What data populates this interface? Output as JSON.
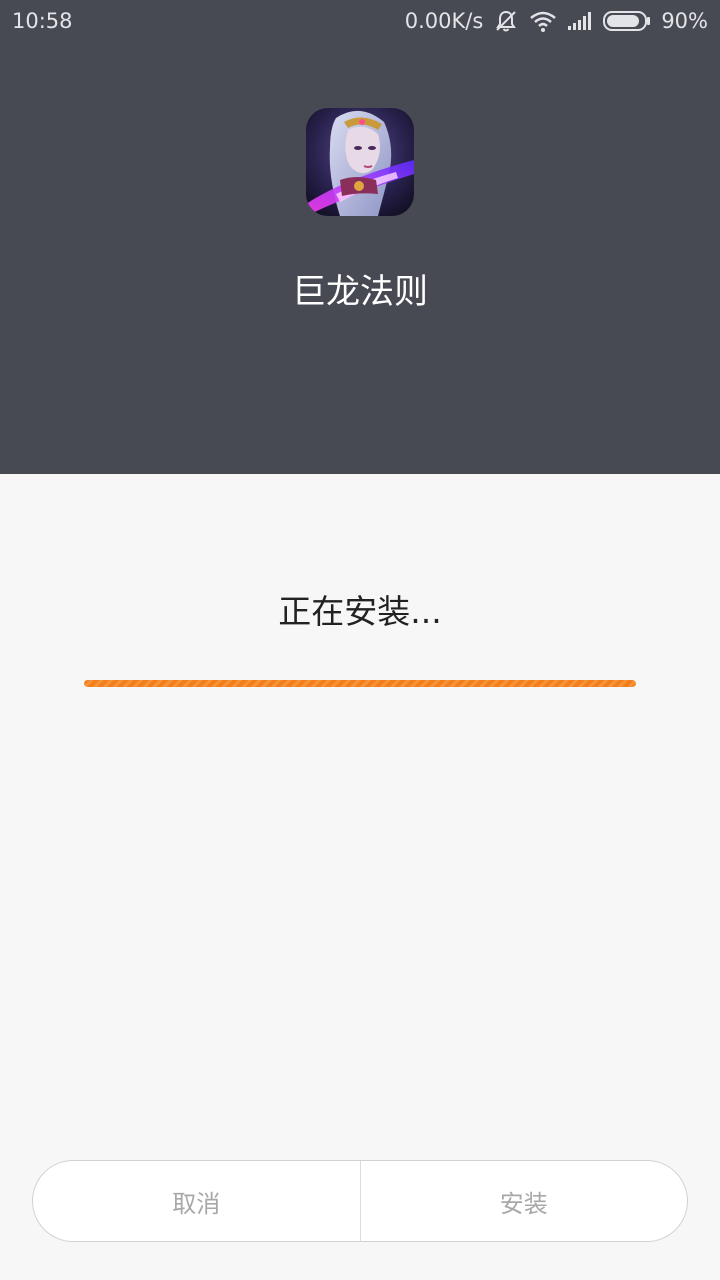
{
  "status_bar": {
    "time": "10:58",
    "network_speed": "0.00K/s",
    "battery_percent": "90%",
    "battery_level": 0.9,
    "icons": [
      "mute-icon",
      "wifi-icon",
      "signal-icon",
      "battery-icon"
    ]
  },
  "app": {
    "name": "巨龙法则",
    "icon": "app-icon"
  },
  "install": {
    "status_text": "正在安装...",
    "progress_fraction": 1.0,
    "progress_color": "#f47f1a"
  },
  "buttons": {
    "cancel_label": "取消",
    "install_label": "安装"
  },
  "colors": {
    "header_bg": "#474a53",
    "body_bg": "#f7f7f7",
    "button_text": "#a8a8a8"
  }
}
